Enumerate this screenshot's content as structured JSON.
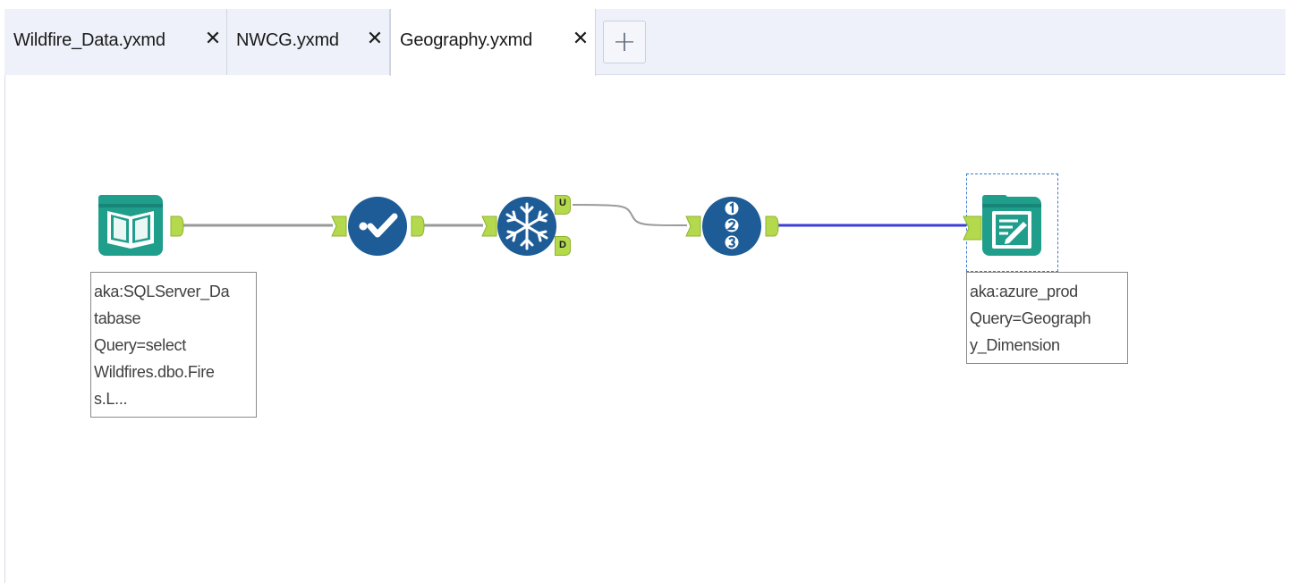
{
  "tabs": [
    {
      "label": "Wildfire_Data.yxmd",
      "close": "✕",
      "active": false
    },
    {
      "label": "NWCG.yxmd",
      "close": "✕",
      "active": false
    },
    {
      "label": "Geography.yxmd",
      "close": "✕",
      "active": true
    }
  ],
  "add_tab_label": "+",
  "workflow": {
    "unique_tool": {
      "output_u": "U",
      "output_d": "D"
    },
    "input_annotation": "aka:SQLServer_Da\ntabase\nQuery=select\nWildfires.dbo.Fire\ns.L...",
    "output_annotation": "aka:azure_prod\nQuery=Geograph\ny_Dimension"
  },
  "colors": {
    "io_teal": "#1f9e8c",
    "tool_blue": "#1d5c96",
    "anchor_green": "#b5d94d",
    "wire_gray": "#9a9a9a",
    "wire_blue": "#3c3cd8"
  }
}
